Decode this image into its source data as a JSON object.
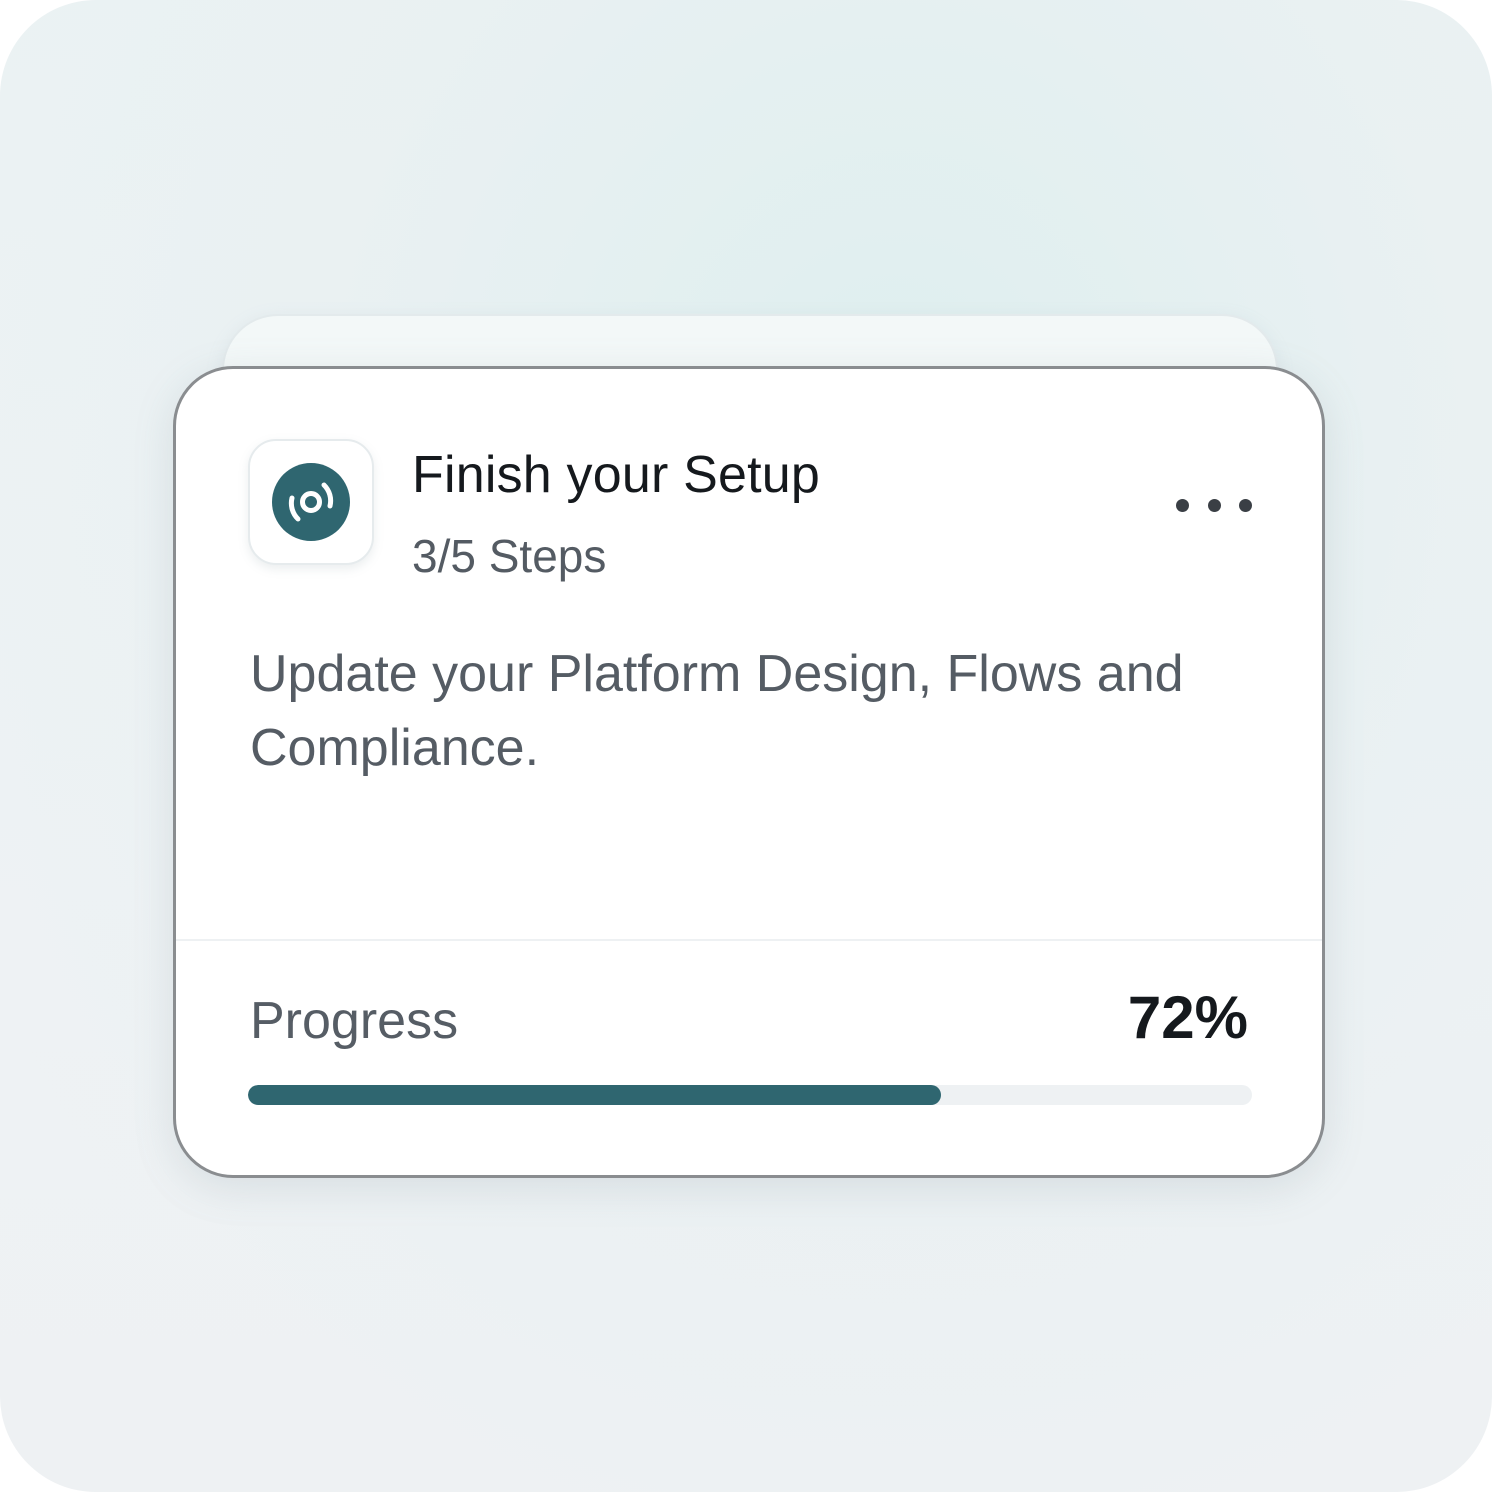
{
  "card": {
    "title": "Finish your Setup",
    "steps": "3/5 Steps",
    "description": "Update your Platform Design, Flows and Compliance.",
    "progress_label": "Progress",
    "progress_text": "72%",
    "progress_fraction": 0.69
  },
  "icons": {
    "app": "broadcast-icon",
    "more": "more-horizontal-icon"
  },
  "colors": {
    "accent": "#2f6670",
    "title_text": "#15191d",
    "muted_text": "#555c64",
    "track": "#eef1f3"
  }
}
